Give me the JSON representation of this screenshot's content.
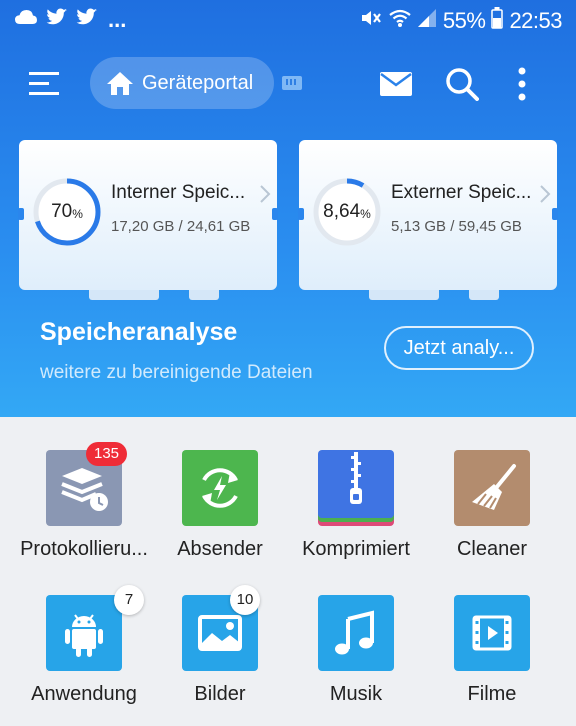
{
  "status_bar": {
    "dots": "...",
    "battery": "55%",
    "time": "22:53"
  },
  "toolbar": {
    "portal_label": "Geräteportal"
  },
  "storage": {
    "internal": {
      "percent": "70",
      "percent_sign": "%",
      "fraction": 0.7,
      "title": "Interner Speic...",
      "usage": "17,20 GB / 24,61 GB"
    },
    "external": {
      "percent": "8,64",
      "percent_sign": "%",
      "fraction": 0.0864,
      "title": "Externer Speic...",
      "usage": "5,13 GB / 59,45 GB"
    }
  },
  "analysis": {
    "title": "Speicheranalyse",
    "subtitle": "weitere zu bereinigende Dateien",
    "button": "Jetzt analy..."
  },
  "categories": [
    {
      "label": "Protokollieru...",
      "icon": "log-icon",
      "badge": "135",
      "color": "#8a97b3"
    },
    {
      "label": "Absender",
      "icon": "sender-icon",
      "badge": "",
      "color": "#4db64e"
    },
    {
      "label": "Komprimiert",
      "icon": "zip-icon",
      "badge": "",
      "color": "#3f74e3"
    },
    {
      "label": "Cleaner",
      "icon": "broom-icon",
      "badge": "",
      "color": "#b38c6e"
    },
    {
      "label": "Anwendung",
      "icon": "android-icon",
      "badge": "7",
      "color": "#27a4e8"
    },
    {
      "label": "Bilder",
      "icon": "image-icon",
      "badge": "10",
      "color": "#27a4e8"
    },
    {
      "label": "Musik",
      "icon": "music-icon",
      "badge": "",
      "color": "#27a4e8"
    },
    {
      "label": "Filme",
      "icon": "film-icon",
      "badge": "",
      "color": "#27a4e8"
    }
  ]
}
